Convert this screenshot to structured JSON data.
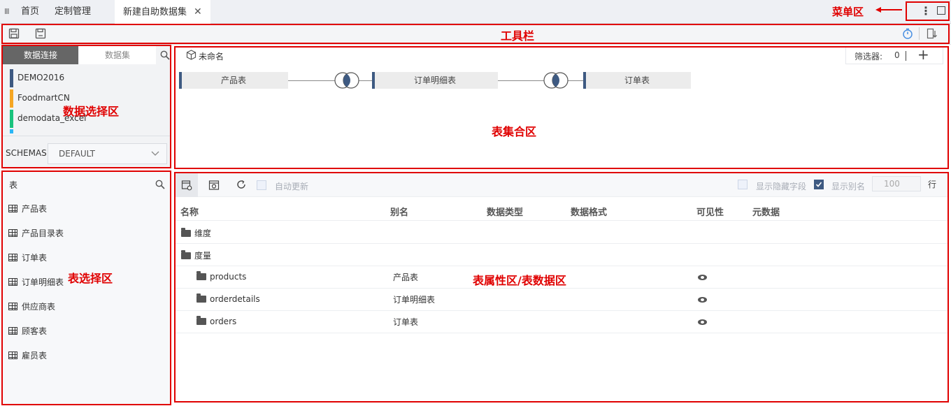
{
  "tabs": {
    "menu_glyph": "Ⅲ",
    "home": "首页",
    "custom": "定制管理",
    "active": "新建自助数据集",
    "close": "✕"
  },
  "menu": {
    "more": "⋮"
  },
  "annotations": {
    "menu_area": "菜单区",
    "toolbar": "工具栏",
    "data_select": "数据选择区",
    "join_area": "表集合区",
    "table_select": "表选择区",
    "props_area": "表属性区/表数据区"
  },
  "source_tabs": {
    "connection": "数据连接",
    "dataset": "数据集"
  },
  "connections": [
    {
      "name": "DEMO2016",
      "color": "#3e5a82"
    },
    {
      "name": "FoodmartCN",
      "color": "#f5a623"
    },
    {
      "name": "demodata_excel",
      "color": "#19c37d"
    }
  ],
  "schemas": {
    "label": "SCHEMAS",
    "value": "DEFAULT"
  },
  "tables_panel": {
    "title": "表",
    "items": [
      "产品表",
      "产品目录表",
      "订单表",
      "订单明细表",
      "供应商表",
      "顾客表",
      "雇员表"
    ]
  },
  "join": {
    "name": "未命名",
    "filter_label": "筛选器:",
    "filter_count": "0",
    "add": "+",
    "nodes": [
      "产品表",
      "订单明细表",
      "订单表"
    ]
  },
  "grid_toolbar": {
    "auto_update": "自动更新",
    "show_hidden": "显示隐藏字段",
    "show_alias": "显示别名",
    "rows_value": "100",
    "rows_unit": "行"
  },
  "columns": [
    "名称",
    "别名",
    "数据类型",
    "数据格式",
    "可见性",
    "元数据"
  ],
  "rows": [
    {
      "name": "维度",
      "alias": "",
      "level": 0,
      "open": false
    },
    {
      "name": "度量",
      "alias": "",
      "level": 0,
      "open": true
    },
    {
      "name": "products",
      "alias": "产品表",
      "level": 1,
      "visible": true
    },
    {
      "name": "orderdetails",
      "alias": "订单明细表",
      "level": 1,
      "visible": true
    },
    {
      "name": "orders",
      "alias": "订单表",
      "level": 1,
      "visible": true
    }
  ]
}
